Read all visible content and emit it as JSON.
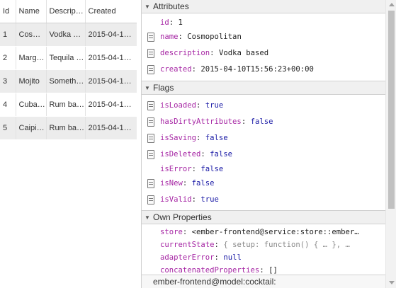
{
  "table": {
    "columns": [
      "Id",
      "Name",
      "Descrip…",
      "Created"
    ],
    "rows": [
      {
        "id": "1",
        "name": "Cosm…",
        "description": "Vodka b…",
        "created": "2015-04-1…"
      },
      {
        "id": "2",
        "name": "Marg…",
        "description": "Tequila …",
        "created": "2015-04-1…"
      },
      {
        "id": "3",
        "name": "Mojito",
        "description": "Someth…",
        "created": "2015-04-1…"
      },
      {
        "id": "4",
        "name": "Cuba…",
        "description": "Rum ba…",
        "created": "2015-04-1…"
      },
      {
        "id": "5",
        "name": "Caipi…",
        "description": "Rum ba…",
        "created": "2015-04-1…"
      }
    ]
  },
  "inspector": {
    "attributes": {
      "title": "Attributes",
      "props": [
        {
          "key": "id",
          "value": "1",
          "editable": false
        },
        {
          "key": "name",
          "value": "Cosmopolitan",
          "editable": true
        },
        {
          "key": "description",
          "value": "Vodka based",
          "editable": true
        },
        {
          "key": "created",
          "value": "2015-04-10T15:56:23+00:00",
          "editable": true
        }
      ]
    },
    "flags": {
      "title": "Flags",
      "props": [
        {
          "key": "isLoaded",
          "value": "true",
          "editable": true
        },
        {
          "key": "hasDirtyAttributes",
          "value": "false",
          "editable": true
        },
        {
          "key": "isSaving",
          "value": "false",
          "editable": true
        },
        {
          "key": "isDeleted",
          "value": "false",
          "editable": true
        },
        {
          "key": "isError",
          "value": "false",
          "editable": false
        },
        {
          "key": "isNew",
          "value": "false",
          "editable": true
        },
        {
          "key": "isValid",
          "value": "true",
          "editable": true
        }
      ]
    },
    "own_properties": {
      "title": "Own Properties",
      "props": [
        {
          "key": "store",
          "value": "<ember-frontend@service:store::ember…"
        },
        {
          "key": "currentState",
          "value": "{ setup: function() { … }, …"
        },
        {
          "key": "adapterError",
          "value": "null"
        },
        {
          "key": "concatenatedProperties",
          "value": "[]"
        }
      ]
    },
    "footer_label": "ember-frontend@model:cocktail:"
  },
  "colors": {
    "key": "#a626a4",
    "keyword": "#1a1aa6",
    "header_bg": "#f0f0f0",
    "stripe": "#ececec"
  }
}
